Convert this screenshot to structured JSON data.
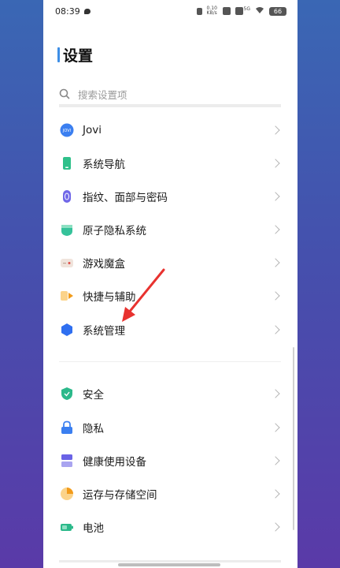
{
  "status_bar": {
    "time": "08:39",
    "net_speed": "0.10 KB/s",
    "net_type": "5G",
    "battery": "66"
  },
  "header": {
    "title": "设置"
  },
  "search": {
    "placeholder": "搜索设置项"
  },
  "items": [
    {
      "label": "Jovi",
      "icon": "jovi-icon",
      "icon_text": "JOVI"
    },
    {
      "label": "系统导航",
      "icon": "system-navigation-icon"
    },
    {
      "label": "指纹、面部与密码",
      "icon": "fingerprint-icon"
    },
    {
      "label": "原子隐私系统",
      "icon": "atom-privacy-icon"
    },
    {
      "label": "游戏魔盒",
      "icon": "game-box-icon"
    },
    {
      "label": "快捷与辅助",
      "icon": "shortcut-arrow-icon"
    },
    {
      "label": "系统管理",
      "icon": "system-management-hexagon-icon"
    },
    {
      "label": "安全",
      "icon": "security-shield-icon"
    },
    {
      "label": "隐私",
      "icon": "privacy-lock-icon"
    },
    {
      "label": "健康使用设备",
      "icon": "healthy-usage-hourglass-icon"
    },
    {
      "label": "运存与存储空间",
      "icon": "storage-pie-icon"
    },
    {
      "label": "电池",
      "icon": "battery-icon"
    }
  ],
  "colors": {
    "accent": "#3d8ee6",
    "arrow": "#e8322f",
    "background_left": "#3a67b4",
    "background_right": "#5a3aa8"
  }
}
